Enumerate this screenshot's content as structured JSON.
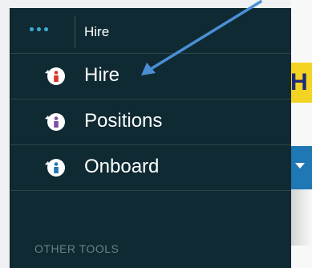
{
  "header": {
    "title": "Hire",
    "more_icon": "more-horizontal-icon"
  },
  "menu": {
    "items": [
      {
        "label": "Hire",
        "icon": "hire-app-icon",
        "accent": "#d9342b"
      },
      {
        "label": "Positions",
        "icon": "positions-app-icon",
        "accent": "#7b4fa8"
      },
      {
        "label": "Onboard",
        "icon": "onboard-app-icon",
        "accent": "#1f77b4"
      }
    ]
  },
  "sections": {
    "other_tools": "OTHER TOOLS"
  },
  "background": {
    "banner_text": "H"
  },
  "colors": {
    "panel": "#102a33",
    "dots": "#39b0d8",
    "annotation_arrow": "#4a8fd4"
  }
}
